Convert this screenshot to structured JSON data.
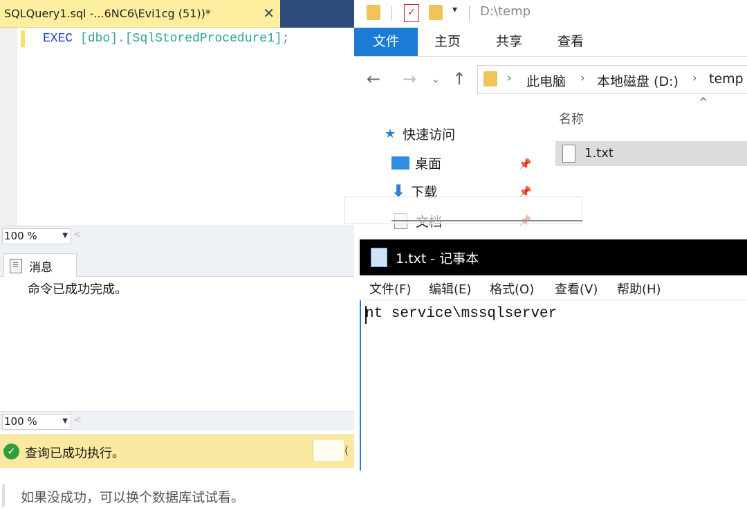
{
  "ssms": {
    "tab_title": "SQLQuery1.sql -...6NC6\\Evi1cg (51))*",
    "close_glyph": "✕",
    "code": {
      "kw": "EXEC",
      "schema": "[dbo]",
      "dot": ".",
      "proc": "[SqlStoredProcedure1]",
      "semi": ";"
    },
    "zoom_top": "100 %",
    "zoom_bottom": "100 %",
    "results_tab": "消息",
    "result_message": "命令已成功完成。",
    "status_text": "查询已成功执行。",
    "status_paren": "("
  },
  "explorer": {
    "path_title": "D:\\temp",
    "ribbon": {
      "file": "文件",
      "home": "主页",
      "share": "共享",
      "view": "查看"
    },
    "breadcrumb": [
      "此电脑",
      "本地磁盘 (D:)",
      "temp"
    ],
    "nav": {
      "quick_access": "快速访问",
      "desktop": "桌面",
      "downloads": "下载",
      "documents": "文档"
    },
    "column_name": "名称",
    "files": [
      "1.txt"
    ]
  },
  "notepad": {
    "title": "1.txt - 记事本",
    "menu": {
      "file": "文件(F)",
      "edit": "编辑(E)",
      "format": "格式(O)",
      "view": "查看(V)",
      "help": "帮助(H)"
    },
    "content": "nt service\\mssqlserver"
  },
  "caption": "如果没成功，可以换个数据库试试看。",
  "colors": {
    "ssms_tab": "#fdeea0",
    "ribbon_file": "#1c7cd5",
    "status_ok": "#2f9e3d",
    "notepad_title": "#000000"
  }
}
